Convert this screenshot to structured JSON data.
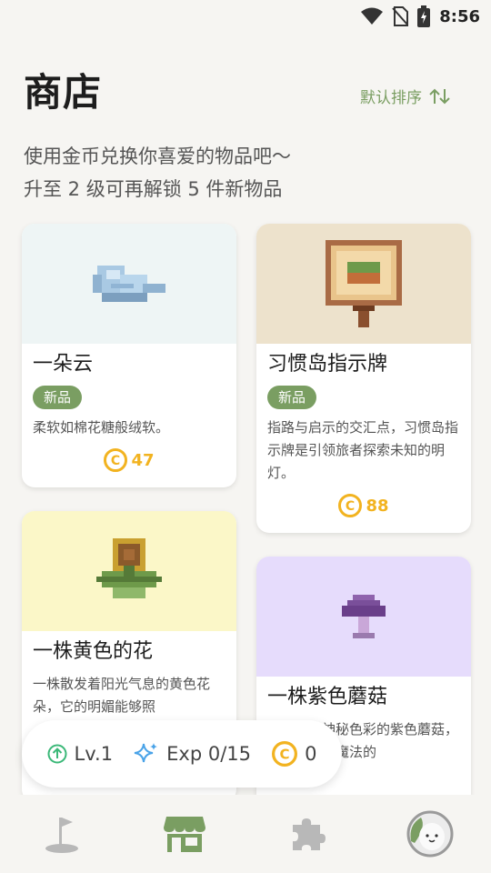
{
  "status_bar": {
    "time": "8:56",
    "icons": [
      "wifi-icon",
      "no-sim-icon",
      "battery-charging-icon"
    ]
  },
  "header": {
    "title": "商店",
    "sort_label": "默认排序",
    "subtitle_line1": "使用金币兑换你喜爱的物品吧～",
    "subtitle_line2": "升至 2 级可再解锁 5 件新物品"
  },
  "products": [
    {
      "name": "一朵云",
      "badge": "新品",
      "desc": "柔软如棉花糖般绒软。",
      "price": "47",
      "icon": "cloud-icon",
      "bg": "#eef5f5"
    },
    {
      "name": "习惯岛指示牌",
      "badge": "新品",
      "desc": "指路与启示的交汇点，习惯岛指示牌是引领旅者探索未知的明灯。",
      "price": "88",
      "icon": "signboard-icon",
      "bg": "#ede2cc"
    },
    {
      "name": "一株黄色的花",
      "badge": "",
      "desc": "一株散发着阳光气息的黄色花朵，它的明媚能够照",
      "price": "",
      "icon": "yellow-flower-icon",
      "bg": "#fbf7c8"
    },
    {
      "name": "一株紫色蘑菇",
      "badge": "",
      "desc": "一株带有神秘色彩的紫色蘑菇，仿佛隐藏着魔法的",
      "price": "",
      "icon": "purple-mushroom-icon",
      "bg": "#e6dcfc"
    }
  ],
  "stats": {
    "level": "Lv.1",
    "exp": "Exp 0/15",
    "coins": "0"
  },
  "bottom_nav": [
    {
      "name": "golf-flag-icon",
      "active": false
    },
    {
      "name": "shop-icon",
      "active": true
    },
    {
      "name": "puzzle-icon",
      "active": false
    },
    {
      "name": "avatar",
      "active": false
    }
  ],
  "colors": {
    "accent": "#7a9e62",
    "coin": "#f2b320",
    "level": "#3bb878",
    "exp": "#4aa3e8"
  }
}
